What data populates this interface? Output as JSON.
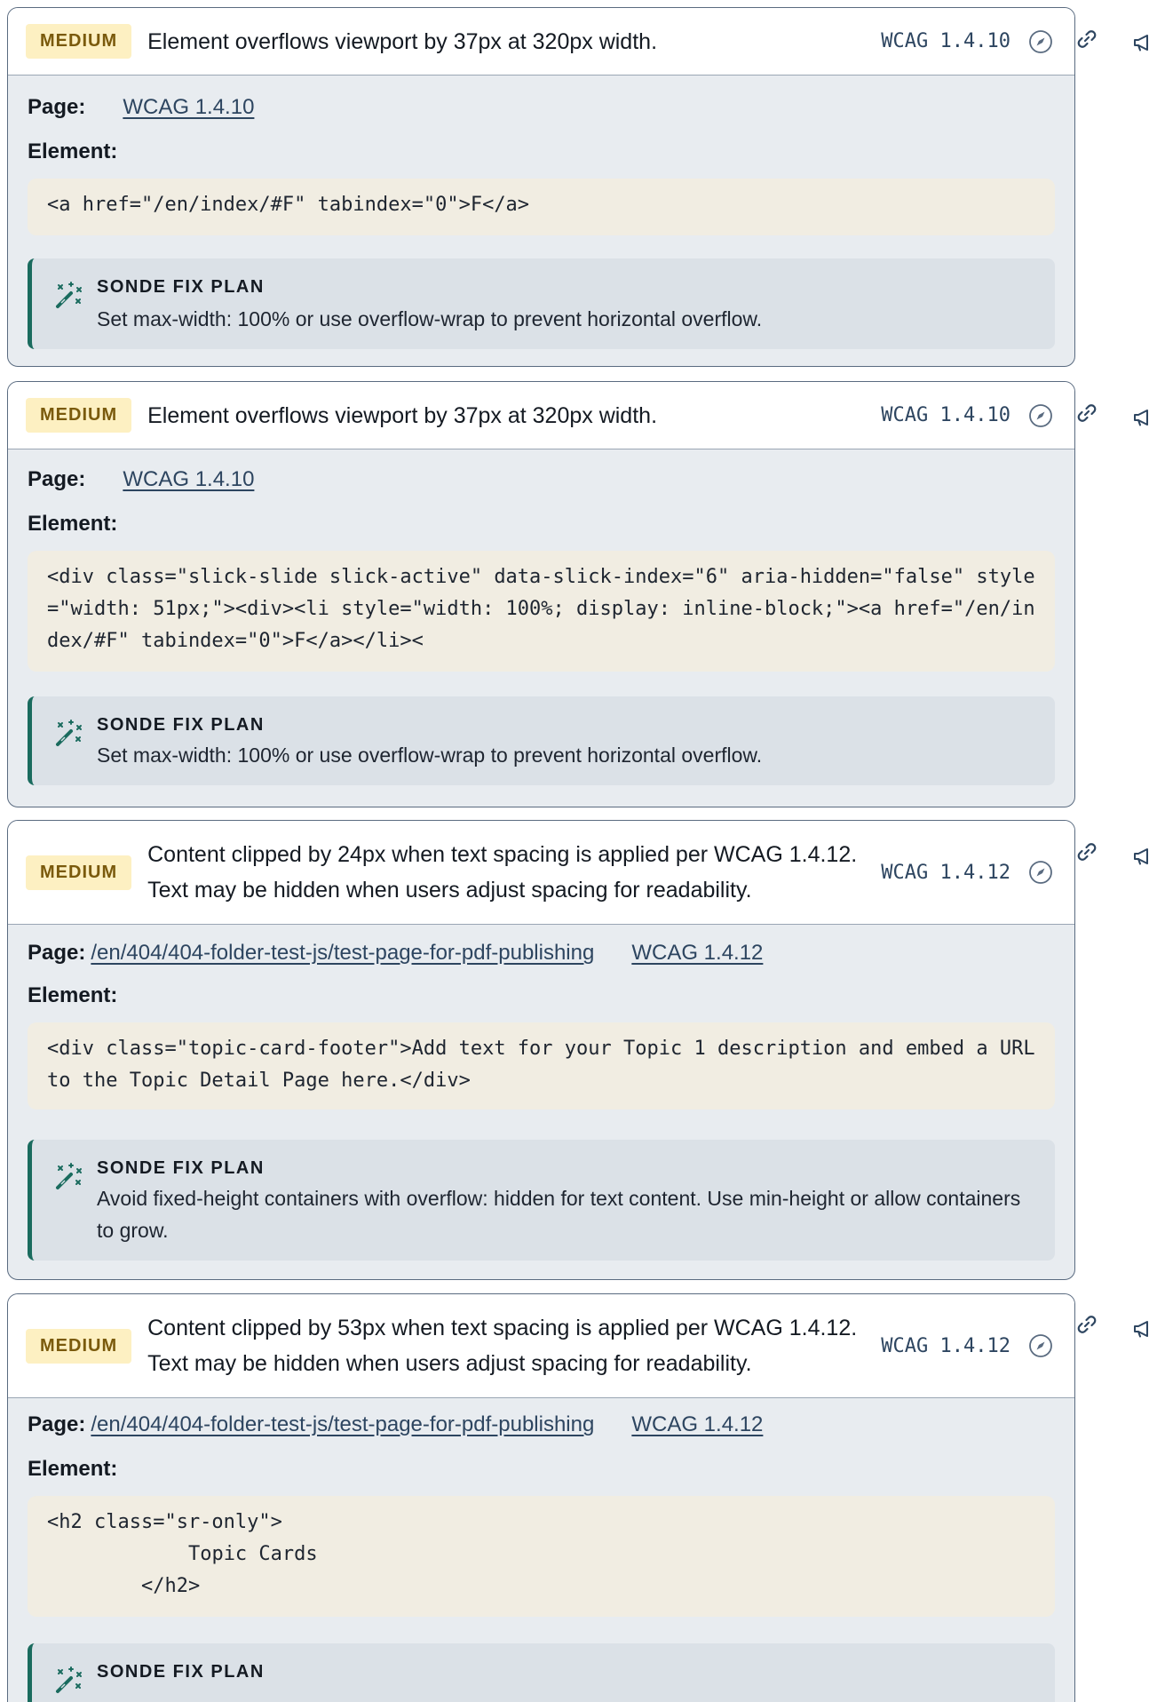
{
  "issues": [
    {
      "severity": "MEDIUM",
      "message": "Element overflows viewport by 37px at 320px width.",
      "wcag": "WCAG 1.4.10",
      "page_label": "Page:",
      "page_path": "",
      "page_link": "WCAG 1.4.10",
      "element_label": "Element:",
      "element_code": "<a href=\"/en/index/#F\" tabindex=\"0\">F</a>",
      "fix_title": "SONDE FIX PLAN",
      "fix_text": "Set max-width: 100% or use overflow-wrap to prevent horizontal overflow."
    },
    {
      "severity": "MEDIUM",
      "message": "Element overflows viewport by 37px at 320px width.",
      "wcag": "WCAG 1.4.10",
      "page_label": "Page:",
      "page_path": "",
      "page_link": "WCAG 1.4.10",
      "element_label": "Element:",
      "element_code": "<div class=\"slick-slide slick-active\" data-slick-index=\"6\" aria-hidden=\"false\" style=\"width: 51px;\"><div><li style=\"width: 100%; display: inline-block;\"><a href=\"/en/index/#F\" tabindex=\"0\">F</a></li><",
      "fix_title": "SONDE FIX PLAN",
      "fix_text": "Set max-width: 100% or use overflow-wrap to prevent horizontal overflow."
    },
    {
      "severity": "MEDIUM",
      "message": "Content clipped by 24px when text spacing is applied per WCAG 1.4.12. Text may be hidden when users adjust spacing for readability.",
      "wcag": "WCAG 1.4.12",
      "page_label": "Page:",
      "page_path": "/en/404/404-folder-test-js/test-page-for-pdf-publishing",
      "page_link": "WCAG 1.4.12",
      "element_label": "Element:",
      "element_code": "<div class=\"topic-card-footer\">Add text for your Topic 1 description and embed a URL to the Topic Detail Page here.</div>",
      "fix_title": "SONDE FIX PLAN",
      "fix_text": "Avoid fixed-height containers with overflow: hidden for text content. Use min-height or allow containers to grow."
    },
    {
      "severity": "MEDIUM",
      "message": "Content clipped by 53px when text spacing is applied per WCAG 1.4.12. Text may be hidden when users adjust spacing for readability.",
      "wcag": "WCAG 1.4.12",
      "page_label": "Page:",
      "page_path": "/en/404/404-folder-test-js/test-page-for-pdf-publishing",
      "page_link": "WCAG 1.4.12",
      "element_label": "Element:",
      "element_code": "<h2 class=\"sr-only\">\n            Topic Cards\n        </h2>",
      "fix_title": "SONDE FIX PLAN",
      "fix_text": ""
    }
  ],
  "icons": {
    "link": "link-icon",
    "megaphone": "megaphone-icon",
    "compass": "compass-icon",
    "fix": "magic-wand-icon"
  },
  "colors": {
    "badge_bg": "#fdf0c2",
    "badge_text": "#7a5a0c",
    "card_border": "#5a6b80",
    "card_bg": "#e8ecf0",
    "code_bg": "#f1ede2",
    "fix_bg": "#dbe1e7",
    "fix_accent": "#1a6b5e",
    "link": "#2d4560"
  }
}
